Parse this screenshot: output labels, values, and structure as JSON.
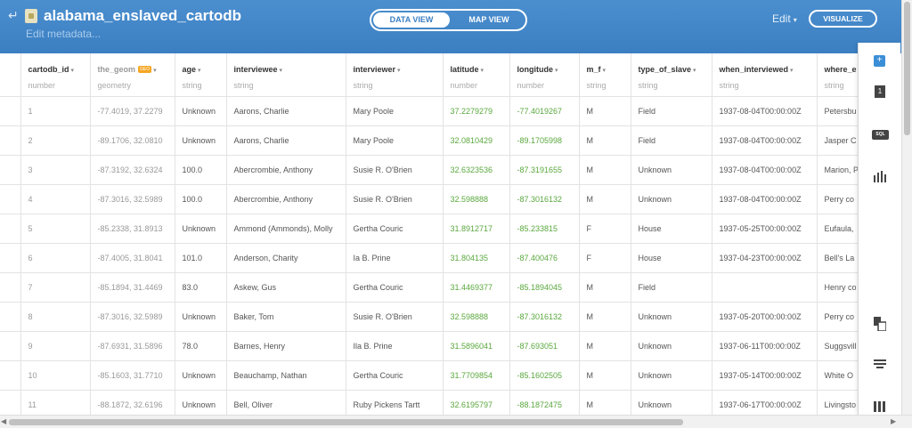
{
  "header": {
    "table_name": "alabama_enslaved_cartodb",
    "edit_metadata": "Edit metadata...",
    "view_tabs": [
      "DATA VIEW",
      "MAP VIEW"
    ],
    "active_tab": "DATA VIEW",
    "edit_label": "Edit",
    "visualize_label": "VISUALIZE"
  },
  "columns": [
    {
      "name": "cartodb_id",
      "type": "number"
    },
    {
      "name": "the_geom",
      "type": "geometry",
      "badge": "GEO"
    },
    {
      "name": "age",
      "type": "string"
    },
    {
      "name": "interviewee",
      "type": "string"
    },
    {
      "name": "interviewer",
      "type": "string"
    },
    {
      "name": "latitude",
      "type": "number"
    },
    {
      "name": "longitude",
      "type": "number"
    },
    {
      "name": "m_f",
      "type": "string"
    },
    {
      "name": "type_of_slave",
      "type": "string"
    },
    {
      "name": "when_interviewed",
      "type": "string"
    },
    {
      "name": "where_e",
      "type": "string"
    }
  ],
  "rows": [
    [
      "1",
      "-77.4019, 37.2279",
      "Unknown",
      "Aarons, Charlie",
      "Mary Poole",
      "37.2279279",
      "-77.4019267",
      "M",
      "Field",
      "1937-08-04T00:00:00Z",
      "Petersbu"
    ],
    [
      "2",
      "-89.1706, 32.0810",
      "Unknown",
      "Aarons, Charlie",
      "Mary Poole",
      "32.0810429",
      "-89.1705998",
      "M",
      "Field",
      "1937-08-04T00:00:00Z",
      "Jasper C"
    ],
    [
      "3",
      "-87.3192, 32.6324",
      "100.0",
      "Abercrombie, Anthony",
      "Susie R. O'Brien",
      "32.6323536",
      "-87.3191655",
      "M",
      "Unknown",
      "1937-08-04T00:00:00Z",
      "Marion, P"
    ],
    [
      "4",
      "-87.3016, 32.5989",
      "100.0",
      "Abercrombie, Anthony",
      "Susie R. O'Brien",
      "32.598888",
      "-87.3016132",
      "M",
      "Unknown",
      "1937-08-04T00:00:00Z",
      "Perry co"
    ],
    [
      "5",
      "-85.2338, 31.8913",
      "Unknown",
      "Ammond (Ammonds), Molly",
      "Gertha Couric",
      "31.8912717",
      "-85.233815",
      "F",
      "House",
      "1937-05-25T00:00:00Z",
      "Eufaula, "
    ],
    [
      "6",
      "-87.4005, 31.8041",
      "101.0",
      "Anderson, Charity",
      "Ia B. Prine",
      "31.804135",
      "-87.400476",
      "F",
      "House",
      "1937-04-23T00:00:00Z",
      "Bell's La"
    ],
    [
      "7",
      "-85.1894, 31.4469",
      "83.0",
      "Askew, Gus",
      "Gertha Couric",
      "31.4469377",
      "-85.1894045",
      "M",
      "Field",
      "",
      "Henry co"
    ],
    [
      "8",
      "-87.3016, 32.5989",
      "Unknown",
      "Baker, Tom",
      "Susie R. O'Brien",
      "32.598888",
      "-87.3016132",
      "M",
      "Unknown",
      "1937-05-20T00:00:00Z",
      "Perry co"
    ],
    [
      "9",
      "-87.6931, 31.5896",
      "78.0",
      "Barnes, Henry",
      "Ila B. Prine",
      "31.5896041",
      "-87.693051",
      "M",
      "Unknown",
      "1937-06-11T00:00:00Z",
      "Suggsvill"
    ],
    [
      "10",
      "-85.1603, 31.7710",
      "Unknown",
      "Beauchamp, Nathan",
      "Gertha Couric",
      "31.7709854",
      "-85.1602505",
      "M",
      "Unknown",
      "1937-05-14T00:00:00Z",
      "White O"
    ],
    [
      "11",
      "-88.1872, 32.6196",
      "Unknown",
      "Bell, Oliver",
      "Ruby Pickens Tartt",
      "32.6195797",
      "-88.1872475",
      "M",
      "Unknown",
      "1937-06-17T00:00:00Z",
      "Livingsto"
    ]
  ],
  "sidebar": {
    "sql_label": "SQL",
    "filter_label": "1",
    "add_label": "+"
  }
}
